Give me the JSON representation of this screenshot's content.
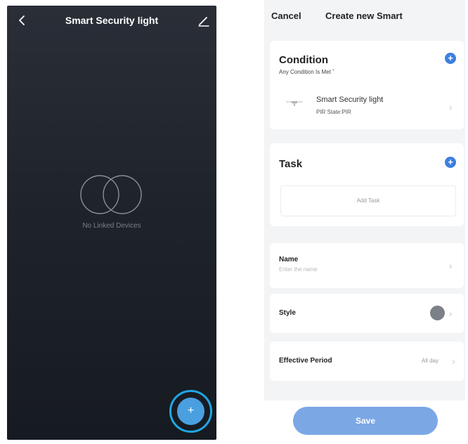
{
  "left_screen": {
    "header": {
      "back_icon": "chevron-left-icon",
      "title": "Smart Security light",
      "edit_icon": "pencil-icon"
    },
    "empty_state": {
      "icon": "linked-rings-icon",
      "text": "No Linked Devices"
    },
    "fab": {
      "label": "+",
      "highlight_color": "#1ea7e4"
    }
  },
  "right_screen": {
    "topbar": {
      "cancel_label": "Cancel",
      "title": "Create new Smart"
    },
    "condition": {
      "title": "Condition",
      "subtitle": "Any Condition Is Met",
      "add_icon": "plus-circle-icon",
      "item": {
        "icon": "light-fixture-icon",
        "name": "Smart Security light",
        "state": "PIR State:PIR"
      }
    },
    "task": {
      "title": "Task",
      "add_icon": "plus-circle-icon",
      "add_task_label": "Add Task"
    },
    "name_row": {
      "label": "Name",
      "placeholder": "Enter the name"
    },
    "style_row": {
      "label": "Style",
      "swatch_color": "#7c8088"
    },
    "period_row": {
      "label": "Effective Period",
      "value": "All day"
    },
    "save_label": "Save",
    "accent_color": "#3c7fe0"
  }
}
